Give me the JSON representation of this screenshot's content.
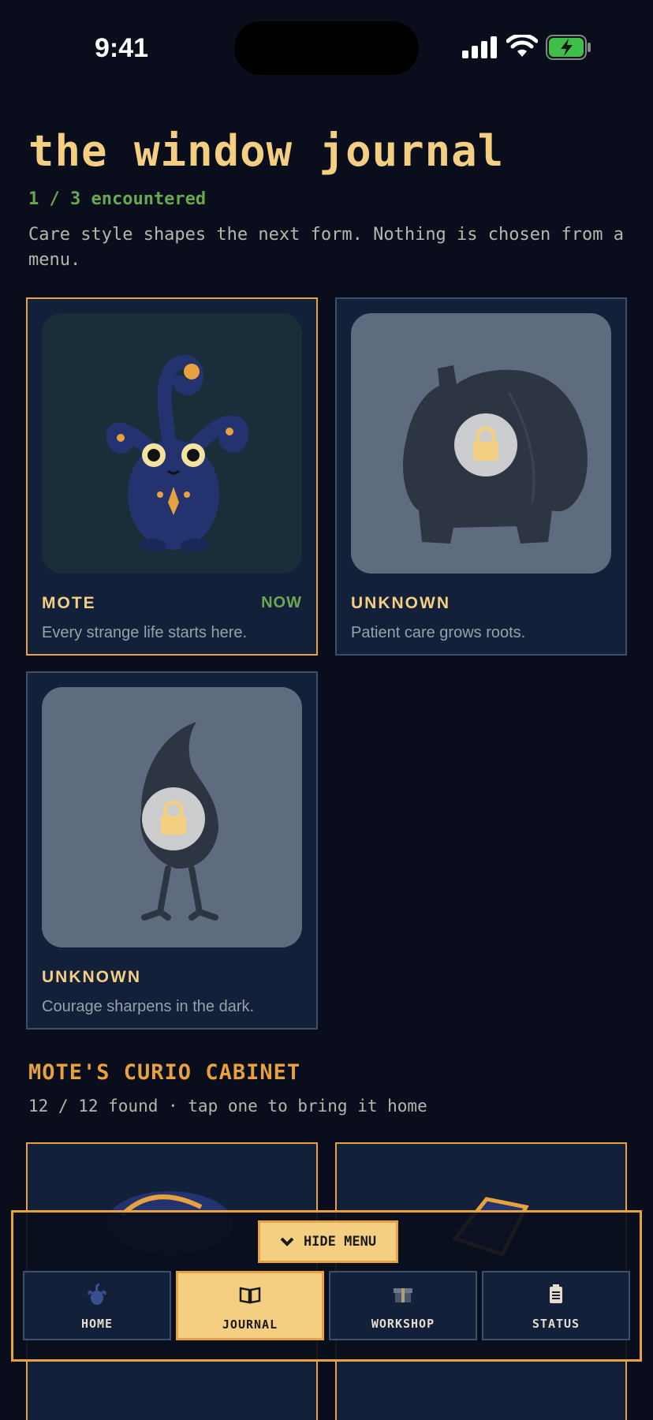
{
  "status_bar": {
    "time": "9:41"
  },
  "header": {
    "title": "the window journal",
    "encountered": "1 / 3 encountered",
    "subtitle": "Care style shapes the next form. Nothing is chosen from a menu."
  },
  "forms": [
    {
      "name": "MOTE",
      "tag": "NOW",
      "description": "Every strange life starts here.",
      "locked": false
    },
    {
      "name": "UNKNOWN",
      "tag": "",
      "description": "Patient care grows roots.",
      "locked": true
    },
    {
      "name": "UNKNOWN",
      "tag": "",
      "description": "Courage sharpens in the dark.",
      "locked": true
    }
  ],
  "cabinet": {
    "title": "MOTE'S CURIO CABINET",
    "subtitle": "12 / 12 found · tap one to bring it home"
  },
  "menu": {
    "hide_label": "HIDE MENU",
    "tabs": [
      {
        "label": "HOME",
        "icon": "creature-icon",
        "active": false
      },
      {
        "label": "JOURNAL",
        "icon": "book-icon",
        "active": true
      },
      {
        "label": "WORKSHOP",
        "icon": "gift-box-icon",
        "active": false
      },
      {
        "label": "STATUS",
        "icon": "clipboard-icon",
        "active": false
      }
    ]
  },
  "colors": {
    "background": "#0a0e1c",
    "accent_gold": "#f4cf82",
    "accent_orange": "#e7a23e",
    "status_green": "#6aa84f",
    "card_bg": "#12203a"
  }
}
